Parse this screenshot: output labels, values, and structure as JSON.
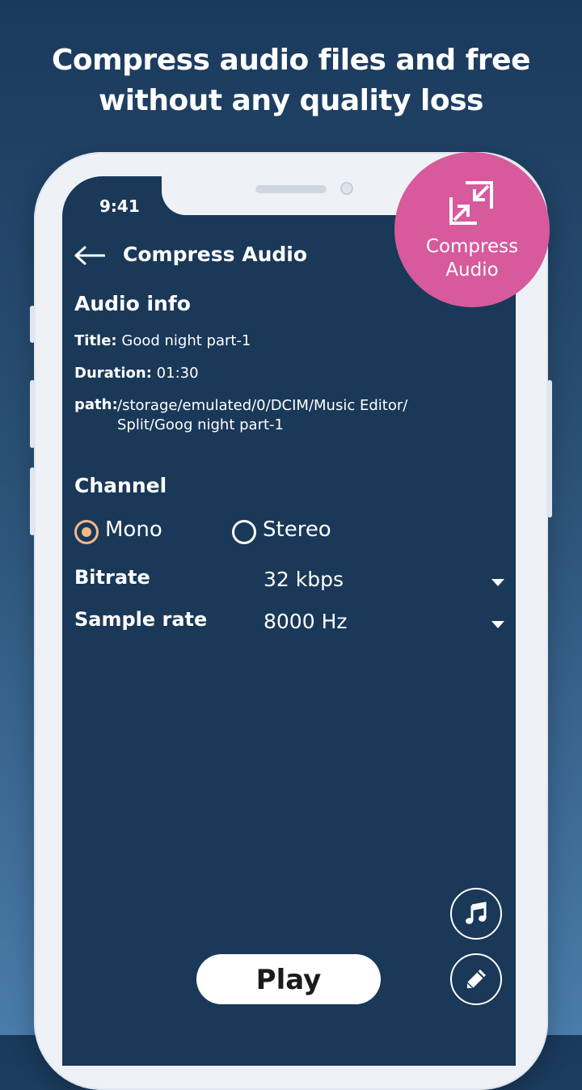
{
  "headline": {
    "line1": "Compress audio files and free",
    "line2": "without any quality loss"
  },
  "status_bar": {
    "time": "9:41"
  },
  "header": {
    "back_icon": "arrow-left-icon",
    "title": "Compress Audio"
  },
  "badge": {
    "icon": "compress-icon",
    "label_line1": "Compress",
    "label_line2": "Audio",
    "color": "#d65a9c"
  },
  "audio_info": {
    "title": "Audio info",
    "title_label": "Title:",
    "title_value": "Good night part-1",
    "duration_label": "Duration:",
    "duration_value": "01:30",
    "path_label": "path:",
    "path_line1": "/storage/emulated/0/DCIM/Music Editor/",
    "path_line2": "Split/Goog night part-1"
  },
  "channel": {
    "title": "Channel",
    "options": [
      {
        "label": "Mono",
        "selected": true
      },
      {
        "label": "Stereo",
        "selected": false
      }
    ]
  },
  "bitrate": {
    "label": "Bitrate",
    "value": "32 kbps"
  },
  "sample_rate": {
    "label": "Sample rate",
    "value": "8000 Hz"
  },
  "fabs": {
    "music": "music-note-icon",
    "edit": "pencil-icon"
  },
  "play_button": {
    "label": "Play"
  },
  "colors": {
    "screen_bg": "#1a3858",
    "accent": "#f2b98a",
    "badge": "#d65a9c"
  }
}
